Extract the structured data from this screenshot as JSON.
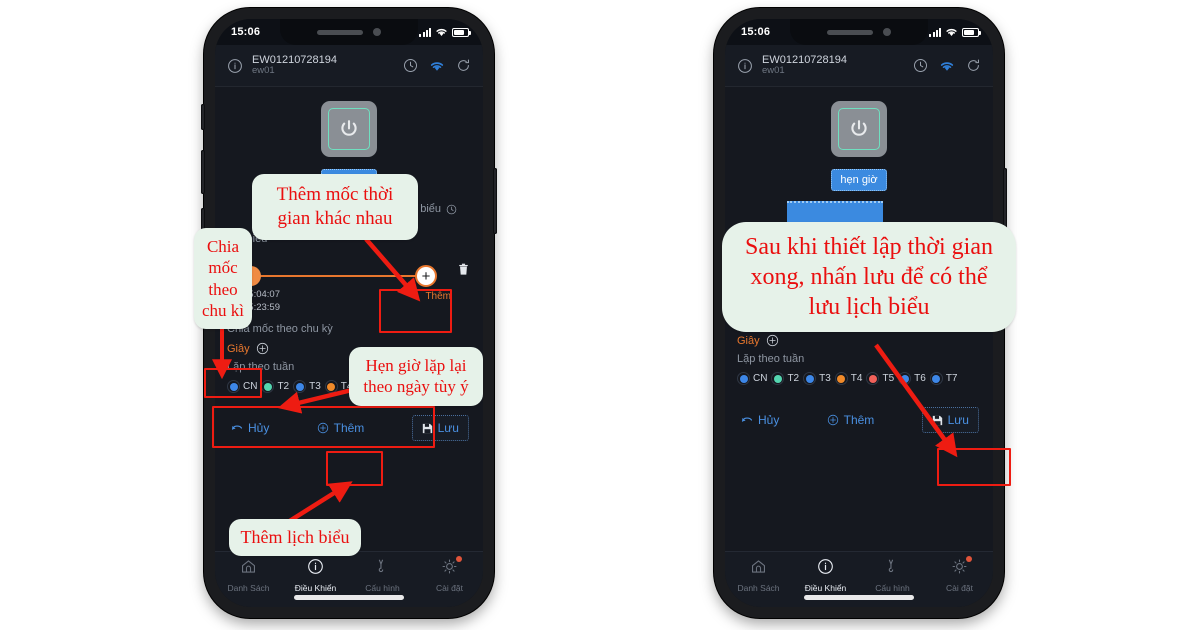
{
  "app": {
    "status": {
      "time": "15:06",
      "signal_icon": "signal-bars-icon",
      "wifi_icon": "wifi-icon",
      "battery_icon": "battery-icon"
    },
    "appbar": {
      "info_icon": "info-circle-icon",
      "device_id": "EW01210728194",
      "device_name": "ew01",
      "icons": [
        "clock-icon",
        "wifi-icon",
        "refresh-icon"
      ]
    },
    "power": {
      "icon": "power-icon",
      "frame_color": "#8a8f95",
      "accent": "#6fe0c0"
    },
    "timer_chip": "hẹn giờ",
    "schedule_tab_label": "lịch biểu",
    "timeline": {
      "start_time": "15:04:07",
      "end_time": "15:23:59",
      "add_label": "Thêm",
      "add_icon": "plus-circle-icon",
      "delete_icon": "trash-icon",
      "accent": "#e8772e"
    },
    "cycle": {
      "section_label": "Chia mốc theo chu kỳ",
      "unit": "Giây",
      "unit_add_icon": "plus-circle-icon"
    },
    "weekly": {
      "section_label": "Lặp theo tuần",
      "days": [
        {
          "label": "CN",
          "color": "#3d87e8"
        },
        {
          "label": "T2",
          "color": "#54d6b0"
        },
        {
          "label": "T3",
          "color": "#3d87e8"
        },
        {
          "label": "T4",
          "color": "#f08a2a"
        },
        {
          "label": "T5",
          "color": "#f0615a"
        },
        {
          "label": "T6",
          "color": "#3d87e8"
        },
        {
          "label": "T7",
          "color": "#3d87e8"
        }
      ]
    },
    "actions": {
      "cancel_label": "Hủy",
      "cancel_icon": "undo-arrow-icon",
      "add_label": "Thêm",
      "add_icon": "plus-circle-icon",
      "save_label": "Lưu",
      "save_icon": "floppy-disk-icon"
    },
    "nav": [
      {
        "label": "Danh Sách",
        "icon": "home-icon",
        "active": false,
        "badge": false
      },
      {
        "label": "Điều Khiển",
        "icon": "info-circle-icon",
        "active": true,
        "badge": false
      },
      {
        "label": "Cấu hình",
        "icon": "wrench-icon",
        "active": false,
        "badge": false
      },
      {
        "label": "Cài đặt",
        "icon": "gear-icon",
        "active": false,
        "badge": true
      }
    ]
  },
  "annotations": {
    "left": {
      "c1": "Thêm mốc thời gian khác nhau",
      "c2": "Chia mốc theo chu kì",
      "c3": "Hẹn giờ lặp lại theo ngày tùy ý",
      "c4": "Thêm lịch biểu"
    },
    "right": {
      "c1": "Sau khi thiết lập thời gian xong, nhấn lưu  để có thể lưu lịch biểu"
    },
    "accent": "#ee1c12",
    "bg": "#e6f2e9"
  }
}
